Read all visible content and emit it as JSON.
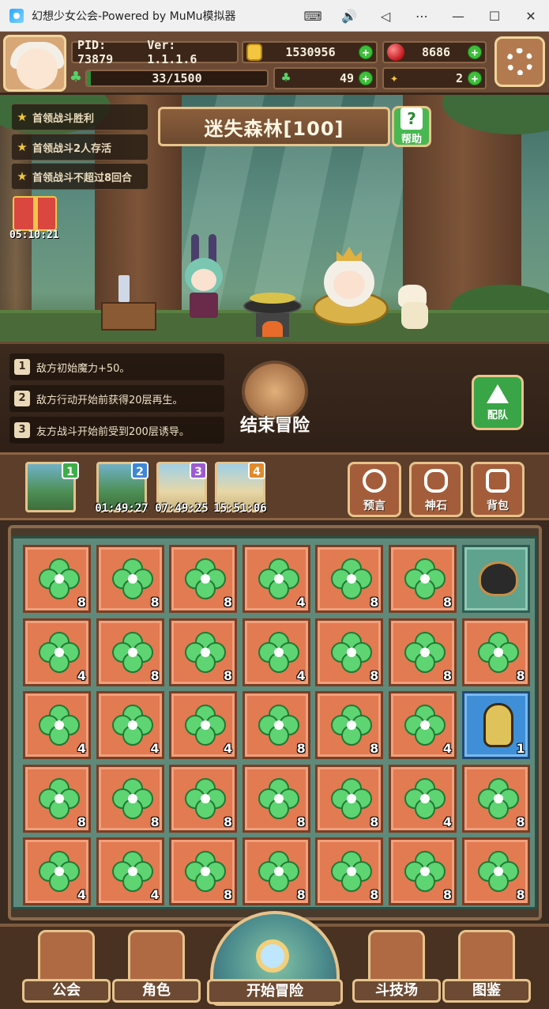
{
  "window": {
    "title": "幻想少女公会-Powered by MuMu模拟器",
    "controls": [
      "⌨",
      "🔊",
      "◁",
      "⋯",
      "—",
      "☐",
      "✕"
    ]
  },
  "header": {
    "pid": "PID: 73879",
    "version": "Ver: 1.1.1.6",
    "gold": "1530956",
    "gems": "8686",
    "clovers": "49",
    "feathers": "2",
    "stamina_text": "33/1500",
    "stamina_fraction": 0.022,
    "icons": {
      "gold": "coin-icon",
      "gems": "ruby-icon",
      "clovers": "clover-icon",
      "feathers": "feather-icon",
      "settings": "gear-icon"
    }
  },
  "stage": {
    "name": "迷失森林[100]",
    "help_label": "帮助",
    "quests": [
      "首领战斗胜利",
      "首领战斗2人存活",
      "首领战斗不超过8回合"
    ],
    "gift_timer": "05:10:21"
  },
  "modifiers": [
    {
      "num": "1",
      "text": "敌方初始魔力+50。"
    },
    {
      "num": "2",
      "text": "敌方行动开始前获得20层再生。"
    },
    {
      "num": "3",
      "text": "友方战斗开始前受到200层诱导。"
    }
  ],
  "actions": {
    "end_adventure": "结束冒险",
    "team": "配队"
  },
  "slots": [
    {
      "badge": "1",
      "timer": "",
      "theme": "forest",
      "badge_color": "#3fae4a"
    },
    {
      "badge": "2",
      "timer": "01:49:27",
      "theme": "forest",
      "badge_color": "#3f86d8"
    },
    {
      "badge": "3",
      "timer": "07:49:25",
      "theme": "desert",
      "badge_color": "#9b5bd3"
    },
    {
      "badge": "4",
      "timer": "15:51:06",
      "theme": "desert",
      "badge_color": "#e08a2a"
    }
  ],
  "tools": [
    "预言",
    "神石",
    "背包"
  ],
  "inventory": [
    [
      "8",
      "8",
      "8",
      "4",
      "8",
      "8",
      "pot"
    ],
    [
      "4",
      "8",
      "8",
      "4",
      "8",
      "8",
      "8"
    ],
    [
      "4",
      "4",
      "4",
      "8",
      "8",
      "4",
      "potion:1"
    ],
    [
      "8",
      "8",
      "8",
      "8",
      "8",
      "4",
      "8"
    ],
    [
      "4",
      "4",
      "8",
      "8",
      "8",
      "8",
      "8"
    ]
  ],
  "nav": {
    "guild": "公会",
    "character": "角色",
    "start": "开始冒险",
    "arena": "斗技场",
    "codex": "图鉴"
  }
}
